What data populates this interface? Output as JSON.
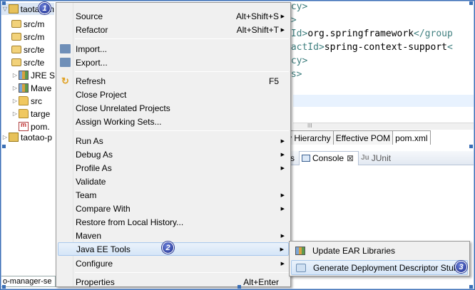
{
  "tree": {
    "items": [
      {
        "label": "taotao-m",
        "icon": "maven-project-icon"
      },
      {
        "label": "src/m",
        "icon": "source-folder-icon"
      },
      {
        "label": "src/m",
        "icon": "source-folder-icon"
      },
      {
        "label": "src/te",
        "icon": "source-folder-icon"
      },
      {
        "label": "src/te",
        "icon": "source-folder-icon"
      },
      {
        "label": "JRE S",
        "icon": "library-icon"
      },
      {
        "label": "Mave",
        "icon": "library-icon"
      },
      {
        "label": "src",
        "icon": "folder-icon"
      },
      {
        "label": "targe",
        "icon": "folder-icon"
      },
      {
        "label": "pom.",
        "icon": "pom-xml-icon"
      },
      {
        "label": "taotao-p",
        "icon": "maven-project-icon"
      }
    ]
  },
  "editor": {
    "lines": [
      {
        "tag": "ncy>",
        "text": ""
      },
      {
        "tag": "s>",
        "text": ""
      },
      {
        "tag": "pId>",
        "text": "org.springframework",
        "close": "</group"
      },
      {
        "tag": "factId>",
        "text": "spring-context-support",
        "close": "<"
      },
      {
        "tag": "ncy>",
        "text": ""
      },
      {
        "tag": "es>",
        "text": ""
      }
    ],
    "scroll_grip": "III",
    "tabs": [
      "y Hierarchy",
      "Effective POM",
      "pom.xml"
    ]
  },
  "views": {
    "tabs": [
      {
        "label": "rs"
      },
      {
        "label": "Console",
        "close": "⊠"
      },
      {
        "label": "JUnit",
        "prefix": "Ju"
      }
    ]
  },
  "status": {
    "left_text": "o-manager-se"
  },
  "context_menu": {
    "groups": [
      [
        {
          "label": "Source",
          "accelerator": "Alt+Shift+S",
          "submenu": true
        },
        {
          "label": "Refactor",
          "accelerator": "Alt+Shift+T",
          "submenu": true
        }
      ],
      [
        {
          "label": "Import...",
          "icon": "import-icon"
        },
        {
          "label": "Export...",
          "icon": "export-icon"
        }
      ],
      [
        {
          "label": "Refresh",
          "accelerator": "F5",
          "icon": "refresh-icon"
        },
        {
          "label": "Close Project"
        },
        {
          "label": "Close Unrelated Projects"
        },
        {
          "label": "Assign Working Sets..."
        }
      ],
      [
        {
          "label": "Run As",
          "submenu": true
        },
        {
          "label": "Debug As",
          "submenu": true
        },
        {
          "label": "Profile As",
          "submenu": true
        },
        {
          "label": "Validate"
        },
        {
          "label": "Team",
          "submenu": true
        },
        {
          "label": "Compare With",
          "submenu": true
        },
        {
          "label": "Restore from Local History..."
        },
        {
          "label": "Maven",
          "submenu": true
        },
        {
          "label": "Java EE Tools",
          "submenu": true,
          "highlighted": true
        },
        {
          "label": "Configure",
          "submenu": true
        }
      ],
      [
        {
          "label": "Properties",
          "accelerator": "Alt+Enter"
        }
      ]
    ]
  },
  "submenu": {
    "items": [
      {
        "label": "Update EAR Libraries",
        "icon": "ear-libraries-icon"
      },
      {
        "label": "Generate Deployment Descriptor Stub",
        "icon": "deployment-descriptor-icon",
        "highlighted": true
      }
    ]
  },
  "badges": [
    "1",
    "2",
    "3"
  ],
  "colors": {
    "xml_tag": "#3f7f7f",
    "callout_badge": "#1f2f8f",
    "menu_highlight": "#d5e5f7"
  }
}
